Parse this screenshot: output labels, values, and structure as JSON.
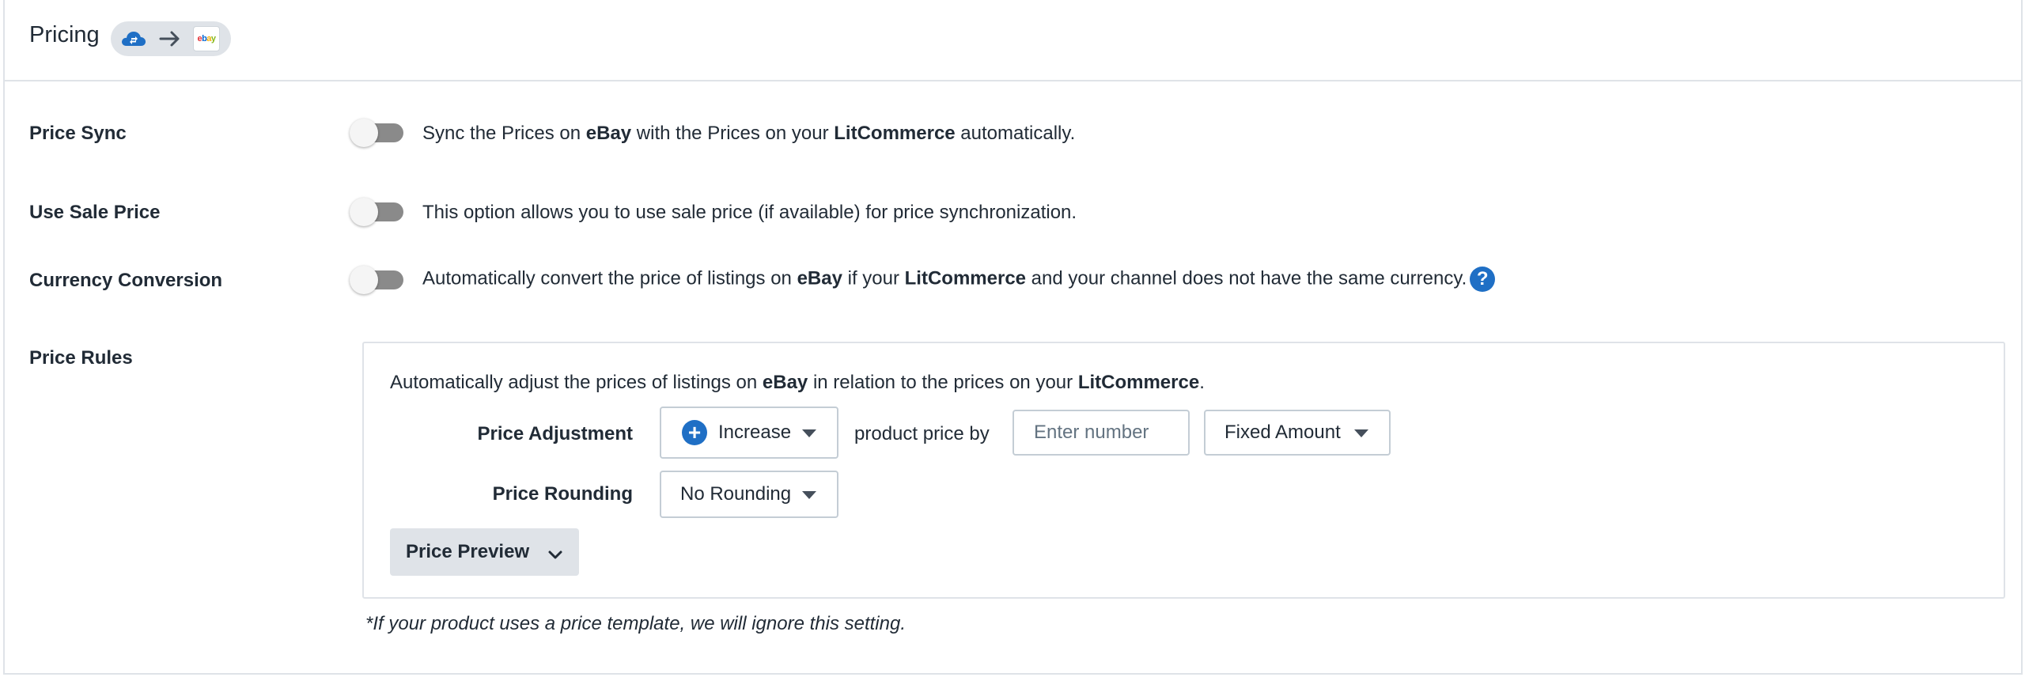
{
  "header": {
    "title": "Pricing",
    "source_icon": "cloud-sync-icon",
    "direction_icon": "arrow-right-icon",
    "channel_logo": "ebay"
  },
  "price_sync": {
    "label": "Price Sync",
    "enabled": false,
    "desc_pre": "Sync the Prices on ",
    "channel": "eBay",
    "desc_mid": " with the Prices on your ",
    "platform": "LitCommerce",
    "desc_post": " automatically."
  },
  "use_sale_price": {
    "label": "Use Sale Price",
    "enabled": false,
    "desc": "This option allows you to use sale price (if available) for price synchronization."
  },
  "currency_conversion": {
    "label": "Currency Conversion",
    "enabled": false,
    "desc_pre": "Automatically convert the price of listings on ",
    "channel": "eBay",
    "desc_mid": " if your ",
    "platform": "LitCommerce",
    "desc_post": " and your channel does not have the same currency.",
    "help": "?"
  },
  "price_rules": {
    "label": "Price Rules",
    "intro_pre": "Automatically adjust the prices of listings on ",
    "channel": "eBay",
    "intro_mid": " in relation to the prices on your ",
    "platform": "LitCommerce",
    "intro_post": ".",
    "adjustment_label": "Price Adjustment",
    "adjustment_value": "Increase",
    "adjustment_connector": "product price by",
    "amount_placeholder": "Enter number",
    "amount_value": "",
    "amount_type": "Fixed Amount",
    "rounding_label": "Price Rounding",
    "rounding_value": "No Rounding",
    "preview_button": "Price Preview",
    "footnote": "*If your product uses a price template, we will ignore this setting."
  },
  "colors": {
    "accent": "#1f6fc5",
    "border": "#dfe3e8",
    "toggle_off": "#8a8a8a"
  }
}
